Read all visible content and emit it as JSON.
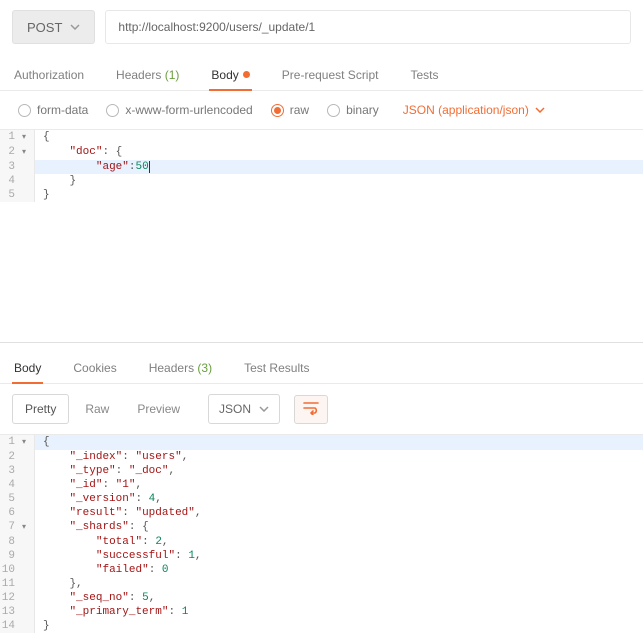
{
  "request": {
    "method": "POST",
    "url": "http://localhost:9200/users/_update/1"
  },
  "request_tabs": {
    "authorization": "Authorization",
    "headers": "Headers",
    "headers_count": "(1)",
    "body": "Body",
    "prerequest": "Pre-request Script",
    "tests": "Tests"
  },
  "body_options": {
    "formdata": "form-data",
    "urlencoded": "x-www-form-urlencoded",
    "raw": "raw",
    "binary": "binary",
    "content_type": "JSON (application/json)"
  },
  "request_body_lines": [
    {
      "n": "1",
      "fold": "▾",
      "code": "{"
    },
    {
      "n": "2",
      "fold": "▾",
      "code": "    \"doc\": {"
    },
    {
      "n": "3",
      "fold": "",
      "code": "        \"age\":50",
      "highlight": true,
      "cursor": true
    },
    {
      "n": "4",
      "fold": "",
      "code": "    }"
    },
    {
      "n": "5",
      "fold": "",
      "code": "}"
    }
  ],
  "response_tabs": {
    "body": "Body",
    "cookies": "Cookies",
    "headers": "Headers",
    "headers_count": "(3)",
    "testresults": "Test Results"
  },
  "toolbar": {
    "pretty": "Pretty",
    "raw": "Raw",
    "preview": "Preview",
    "format": "JSON"
  },
  "response_body_lines": [
    {
      "n": "1",
      "fold": "▾",
      "code": "{",
      "highlight": true
    },
    {
      "n": "2",
      "fold": "",
      "code": "    \"_index\": \"users\","
    },
    {
      "n": "3",
      "fold": "",
      "code": "    \"_type\": \"_doc\","
    },
    {
      "n": "4",
      "fold": "",
      "code": "    \"_id\": \"1\","
    },
    {
      "n": "5",
      "fold": "",
      "code": "    \"_version\": 4,"
    },
    {
      "n": "6",
      "fold": "",
      "code": "    \"result\": \"updated\","
    },
    {
      "n": "7",
      "fold": "▾",
      "code": "    \"_shards\": {"
    },
    {
      "n": "8",
      "fold": "",
      "code": "        \"total\": 2,"
    },
    {
      "n": "9",
      "fold": "",
      "code": "        \"successful\": 1,"
    },
    {
      "n": "10",
      "fold": "",
      "code": "        \"failed\": 0"
    },
    {
      "n": "11",
      "fold": "",
      "code": "    },"
    },
    {
      "n": "12",
      "fold": "",
      "code": "    \"_seq_no\": 5,"
    },
    {
      "n": "13",
      "fold": "",
      "code": "    \"_primary_term\": 1"
    },
    {
      "n": "14",
      "fold": "",
      "code": "}"
    }
  ]
}
